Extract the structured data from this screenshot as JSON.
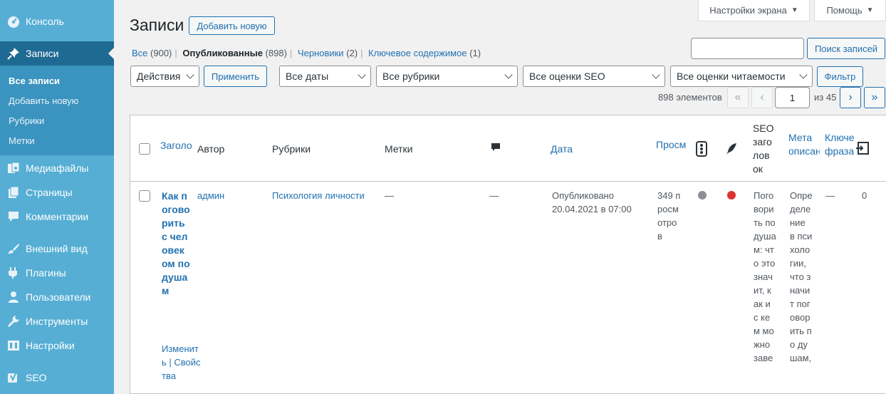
{
  "sidebar": {
    "items": [
      {
        "label": "Консоль",
        "icon": "dashboard-icon"
      },
      {
        "label": "Записи",
        "icon": "pushpin-icon"
      },
      {
        "label": "Медиафайлы",
        "icon": "media-icon"
      },
      {
        "label": "Страницы",
        "icon": "pages-icon"
      },
      {
        "label": "Комментарии",
        "icon": "comment-icon"
      },
      {
        "label": "Внешний вид",
        "icon": "brush-icon"
      },
      {
        "label": "Плагины",
        "icon": "plugin-icon"
      },
      {
        "label": "Пользователи",
        "icon": "users-icon"
      },
      {
        "label": "Инструменты",
        "icon": "wrench-icon"
      },
      {
        "label": "Настройки",
        "icon": "settings-icon"
      },
      {
        "label": "SEO",
        "icon": "yoast-icon"
      }
    ],
    "submenu": [
      "Все записи",
      "Добавить новую",
      "Рубрики",
      "Метки"
    ]
  },
  "header": {
    "title": "Записи",
    "add_new": "Добавить новую",
    "screen_options": "Настройки экрана",
    "help": "Помощь"
  },
  "views": {
    "all_label": "Все",
    "all_count": "(900)",
    "published_label": "Опубликованные",
    "published_count": "(898)",
    "drafts_label": "Черновики",
    "drafts_count": "(2)",
    "cornerstone_label": "Ключевое содержимое",
    "cornerstone_count": "(1)"
  },
  "search": {
    "value": "",
    "button": "Поиск записей"
  },
  "filters": {
    "bulk_action": "Действия",
    "apply": "Применить",
    "dates": "Все даты",
    "categories": "Все рубрики",
    "seo_scores": "Все оценки SEO",
    "readability": "Все оценки читаемости",
    "filter_button": "Фильтр"
  },
  "pagination": {
    "items_count": "898 элементов",
    "first": "«",
    "prev": "‹",
    "current_page": "1",
    "of_total": "из 45",
    "next": "›",
    "last": "»"
  },
  "table": {
    "headers": {
      "title": "Заголо",
      "author": "Автор",
      "categories": "Рубрики",
      "tags": "Метки",
      "date": "Дата",
      "views": "Просм",
      "seo_title": "SEO заголовок",
      "meta_desc": "Мета описан",
      "keyphrase": "Ключе фраза"
    },
    "rows": [
      {
        "title": "Как поговорить с человеком по душам",
        "actions": "Изменить | Свойства",
        "author": "админ",
        "category": "Психология личности",
        "tags": "—",
        "comments": "—",
        "date_status": "Опубликовано",
        "date": "20.04.2021 в 07:00",
        "views": "349 просмотров",
        "seo_score_color": "#8c8f94",
        "readability_color": "#dc3232",
        "seo_title": "Поговорить по душам: что это значит, как и с кем можно заве",
        "meta_desc": "Определение в психологии, что значит поговорить по душам,",
        "keyphrase": "—",
        "links": "0"
      }
    ]
  }
}
